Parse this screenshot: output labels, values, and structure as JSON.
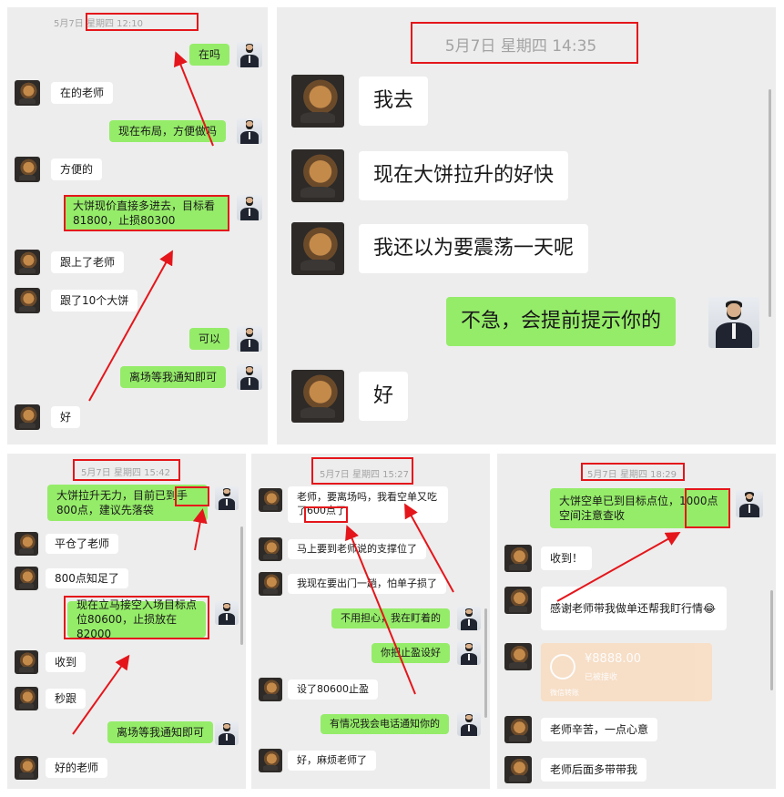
{
  "panels": {
    "p1": {
      "timestamp": "5月7日 星期四 12:10",
      "messages": [
        {
          "who": "me",
          "text": "在吗"
        },
        {
          "who": "other",
          "text": "在的老师"
        },
        {
          "who": "me",
          "text": "现在布局，方便做吗"
        },
        {
          "who": "other",
          "text": "方便的"
        },
        {
          "who": "me",
          "text": "大饼现价直接多进去，目标看81800，止损80300"
        },
        {
          "who": "other",
          "text": "跟上了老师"
        },
        {
          "who": "other",
          "text": "跟了10个大饼"
        },
        {
          "who": "me",
          "text": "可以"
        },
        {
          "who": "me",
          "text": "离场等我通知即可"
        },
        {
          "who": "other",
          "text": "好"
        }
      ]
    },
    "p2": {
      "timestamp": "5月7日 星期四 14:35",
      "messages": [
        {
          "who": "other",
          "text": "我去"
        },
        {
          "who": "other",
          "text": "现在大饼拉升的好快"
        },
        {
          "who": "other",
          "text": "我还以为要震荡一天呢"
        },
        {
          "who": "me",
          "text": "不急，会提前提示你的"
        },
        {
          "who": "other",
          "text": "好"
        }
      ]
    },
    "p3": {
      "timestamp": "5月7日 星期四 15:42",
      "messages": [
        {
          "who": "me",
          "text": "大饼拉升无力，目前已到手800点，建议先落袋"
        },
        {
          "who": "other",
          "text": "平仓了老师"
        },
        {
          "who": "other",
          "text": "800点知足了"
        },
        {
          "who": "me",
          "text": "现在立马接空入场目标点位80600，止损放在82000"
        },
        {
          "who": "other",
          "text": "收到"
        },
        {
          "who": "other",
          "text": "秒跟"
        },
        {
          "who": "me",
          "text": "离场等我通知即可"
        },
        {
          "who": "other",
          "text": "好的老师"
        }
      ]
    },
    "p4": {
      "timestamp": "5月7日 星期四 15:27",
      "messages": [
        {
          "who": "other",
          "text": "老师，要离场吗，我看空单又吃了600点了"
        },
        {
          "who": "other",
          "text": "马上要到老师说的支撑位了"
        },
        {
          "who": "other",
          "text": "我现在要出门一趟，怕单子损了"
        },
        {
          "who": "me",
          "text": "不用担心，我在盯着的"
        },
        {
          "who": "me",
          "text": "你把止盈设好"
        },
        {
          "who": "other",
          "text": "设了80600止盈"
        },
        {
          "who": "me",
          "text": "有情况我会电话通知你的"
        },
        {
          "who": "other",
          "text": "好，麻烦老师了"
        }
      ]
    },
    "p5": {
      "timestamp": "5月7日 星期四 18:29",
      "messages": [
        {
          "who": "me",
          "text": "大饼空单已到目标点位，1000点空间注意查收"
        },
        {
          "who": "other",
          "text": "收到！"
        },
        {
          "who": "other",
          "text": "感谢老师带我做单还帮我盯行情😂"
        },
        {
          "who": "other",
          "text": "老师辛苦，一点心意"
        },
        {
          "who": "other",
          "text": "老师后面多带带我"
        }
      ],
      "transfer": {
        "amount": "¥8888.00",
        "status": "已被接收",
        "footer": "微信转账"
      }
    }
  },
  "colors": {
    "me_bubble": "#95ec69",
    "other_bubble": "#ffffff",
    "annotation": "#e4161b",
    "background": "#ededed"
  }
}
